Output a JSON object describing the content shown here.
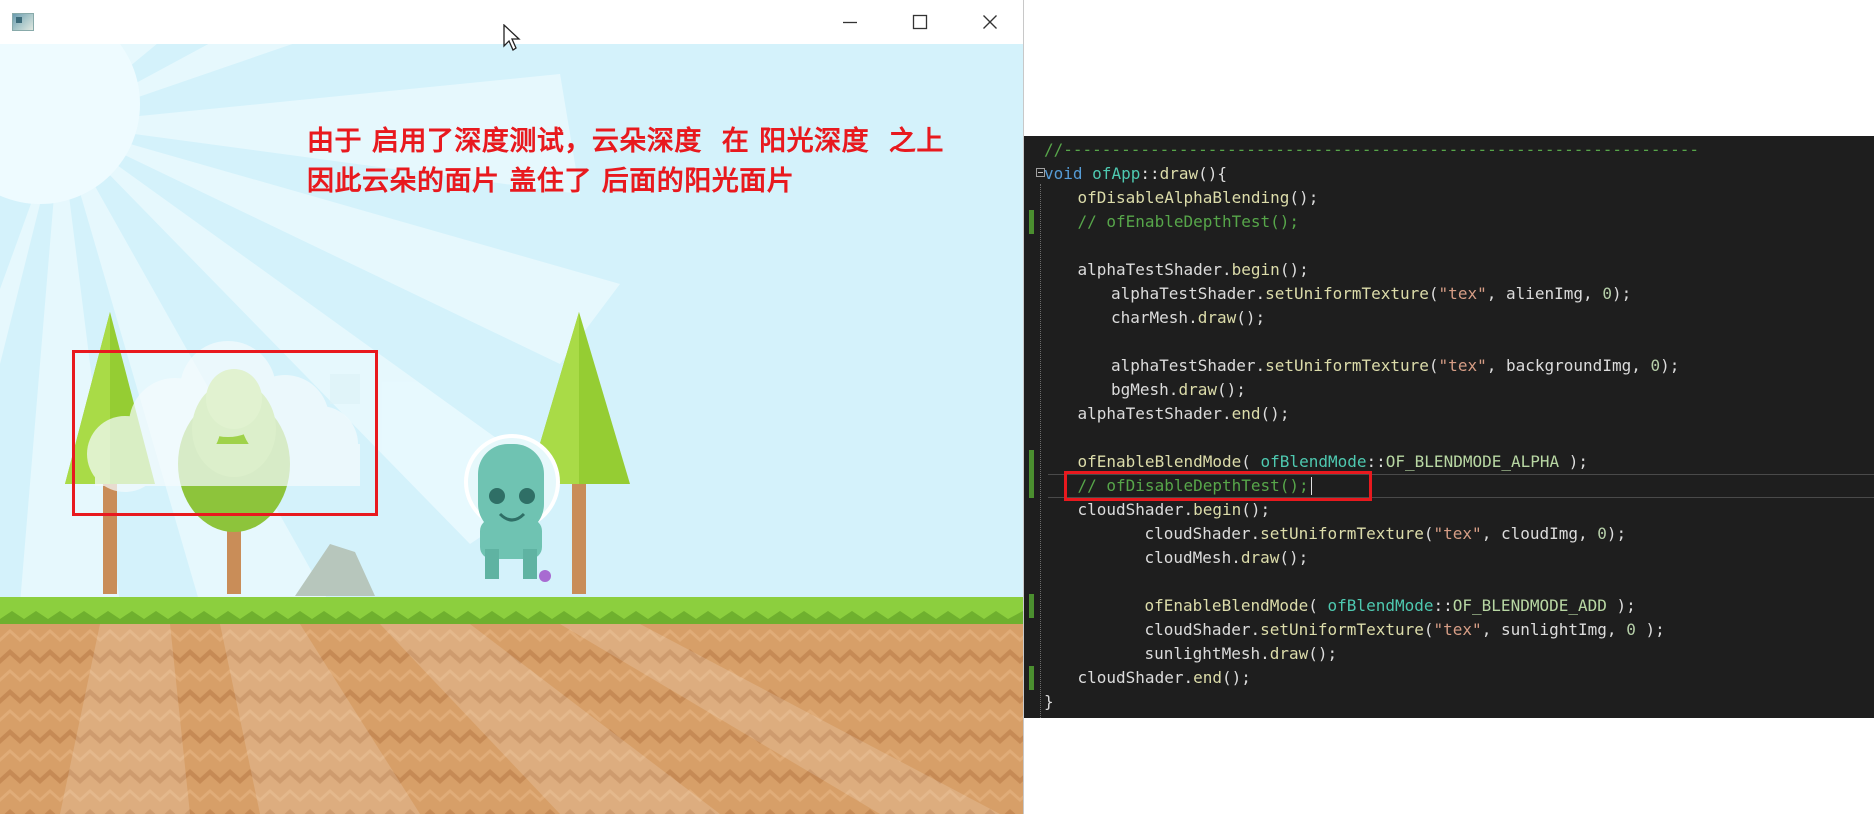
{
  "window": {
    "title": "",
    "controls": {
      "minimize_icon": "minimize-icon",
      "maximize_icon": "maximize-icon",
      "close_icon": "close-icon"
    }
  },
  "scene": {
    "annotation": "由于 启用了深度测试，云朵深度  在 阳光深度  之上\n因此云朵的面片 盖住了 后面的阳光面片",
    "colors": {
      "sky": "#d4f2fb",
      "sun_rays": "#e6f8fe",
      "grass": "#8ccf3e",
      "dirt": "#d79f68",
      "tree_foliage": "#95cd33",
      "trunk": "#c98d58",
      "alien": "#6fc3b2",
      "highlight": "#e8191e"
    }
  },
  "code": {
    "colors": {
      "background": "#1e1e1e",
      "comment": "#57a64a",
      "keyword": "#569cd6",
      "type": "#4ec9b0",
      "function": "#dcdcaa",
      "string": "#d69d85",
      "number": "#b5cea8",
      "plain": "#dcdcdc",
      "change_marker": "#4b8f2f"
    },
    "lines": [
      {
        "indent": 0,
        "changed": false,
        "tokens": [
          {
            "t": "//------------------------------------------------------------------",
            "c": "comment"
          }
        ]
      },
      {
        "indent": 0,
        "changed": false,
        "fold": true,
        "tokens": [
          {
            "t": "void ",
            "c": "keyword"
          },
          {
            "t": "ofApp",
            "c": "type"
          },
          {
            "t": "::",
            "c": "plain"
          },
          {
            "t": "draw",
            "c": "func"
          },
          {
            "t": "(){",
            "c": "plain"
          }
        ]
      },
      {
        "indent": 1,
        "changed": false,
        "tokens": [
          {
            "t": "ofDisableAlphaBlending",
            "c": "func"
          },
          {
            "t": "();",
            "c": "plain"
          }
        ]
      },
      {
        "indent": 1,
        "changed": true,
        "tokens": [
          {
            "t": "// ofEnableDepthTest();",
            "c": "comment"
          }
        ]
      },
      {
        "indent": 0,
        "changed": false,
        "tokens": []
      },
      {
        "indent": 1,
        "changed": false,
        "tokens": [
          {
            "t": "alphaTestShader",
            "c": "plain"
          },
          {
            "t": ".",
            "c": "plain"
          },
          {
            "t": "begin",
            "c": "func"
          },
          {
            "t": "();",
            "c": "plain"
          }
        ]
      },
      {
        "indent": 2,
        "changed": false,
        "tokens": [
          {
            "t": "alphaTestShader",
            "c": "plain"
          },
          {
            "t": ".",
            "c": "plain"
          },
          {
            "t": "setUniformTexture",
            "c": "func"
          },
          {
            "t": "(",
            "c": "plain"
          },
          {
            "t": "\"tex\"",
            "c": "string"
          },
          {
            "t": ", alienImg, ",
            "c": "plain"
          },
          {
            "t": "0",
            "c": "number"
          },
          {
            "t": ");",
            "c": "plain"
          }
        ]
      },
      {
        "indent": 2,
        "changed": false,
        "tokens": [
          {
            "t": "charMesh",
            "c": "plain"
          },
          {
            "t": ".",
            "c": "plain"
          },
          {
            "t": "draw",
            "c": "func"
          },
          {
            "t": "();",
            "c": "plain"
          }
        ]
      },
      {
        "indent": 0,
        "changed": false,
        "tokens": []
      },
      {
        "indent": 2,
        "changed": false,
        "tokens": [
          {
            "t": "alphaTestShader",
            "c": "plain"
          },
          {
            "t": ".",
            "c": "plain"
          },
          {
            "t": "setUniformTexture",
            "c": "func"
          },
          {
            "t": "(",
            "c": "plain"
          },
          {
            "t": "\"tex\"",
            "c": "string"
          },
          {
            "t": ", backgroundImg, ",
            "c": "plain"
          },
          {
            "t": "0",
            "c": "number"
          },
          {
            "t": ");",
            "c": "plain"
          }
        ]
      },
      {
        "indent": 2,
        "changed": false,
        "tokens": [
          {
            "t": "bgMesh",
            "c": "plain"
          },
          {
            "t": ".",
            "c": "plain"
          },
          {
            "t": "draw",
            "c": "func"
          },
          {
            "t": "();",
            "c": "plain"
          }
        ]
      },
      {
        "indent": 1,
        "changed": false,
        "tokens": [
          {
            "t": "alphaTestShader",
            "c": "plain"
          },
          {
            "t": ".",
            "c": "plain"
          },
          {
            "t": "end",
            "c": "func"
          },
          {
            "t": "();",
            "c": "plain"
          }
        ]
      },
      {
        "indent": 0,
        "changed": false,
        "tokens": []
      },
      {
        "indent": 1,
        "changed": true,
        "tokens": [
          {
            "t": "ofEnableBlendMode",
            "c": "func"
          },
          {
            "t": "( ",
            "c": "plain"
          },
          {
            "t": "ofBlendMode",
            "c": "type"
          },
          {
            "t": "::",
            "c": "plain"
          },
          {
            "t": "OF_BLENDMODE_ALPHA",
            "c": "enum"
          },
          {
            "t": " );",
            "c": "plain"
          }
        ]
      },
      {
        "indent": 1,
        "changed": true,
        "current": true,
        "tokens": [
          {
            "t": "// ofDisableDepthTest();",
            "c": "comment"
          }
        ]
      },
      {
        "indent": 1,
        "changed": false,
        "tokens": [
          {
            "t": "cloudShader",
            "c": "plain"
          },
          {
            "t": ".",
            "c": "plain"
          },
          {
            "t": "begin",
            "c": "func"
          },
          {
            "t": "();",
            "c": "plain"
          }
        ]
      },
      {
        "indent": 3,
        "changed": false,
        "tokens": [
          {
            "t": "cloudShader",
            "c": "plain"
          },
          {
            "t": ".",
            "c": "plain"
          },
          {
            "t": "setUniformTexture",
            "c": "func"
          },
          {
            "t": "(",
            "c": "plain"
          },
          {
            "t": "\"tex\"",
            "c": "string"
          },
          {
            "t": ", cloudImg, ",
            "c": "plain"
          },
          {
            "t": "0",
            "c": "number"
          },
          {
            "t": ");",
            "c": "plain"
          }
        ]
      },
      {
        "indent": 3,
        "changed": false,
        "tokens": [
          {
            "t": "cloudMesh",
            "c": "plain"
          },
          {
            "t": ".",
            "c": "plain"
          },
          {
            "t": "draw",
            "c": "func"
          },
          {
            "t": "();",
            "c": "plain"
          }
        ]
      },
      {
        "indent": 0,
        "changed": false,
        "tokens": []
      },
      {
        "indent": 3,
        "changed": true,
        "tokens": [
          {
            "t": "ofEnableBlendMode",
            "c": "func"
          },
          {
            "t": "( ",
            "c": "plain"
          },
          {
            "t": "ofBlendMode",
            "c": "type"
          },
          {
            "t": "::",
            "c": "plain"
          },
          {
            "t": "OF_BLENDMODE_ADD",
            "c": "enum"
          },
          {
            "t": " );",
            "c": "plain"
          }
        ]
      },
      {
        "indent": 3,
        "changed": false,
        "tokens": [
          {
            "t": "cloudShader",
            "c": "plain"
          },
          {
            "t": ".",
            "c": "plain"
          },
          {
            "t": "setUniformTexture",
            "c": "func"
          },
          {
            "t": "(",
            "c": "plain"
          },
          {
            "t": "\"tex\"",
            "c": "string"
          },
          {
            "t": ", sunlightImg, ",
            "c": "plain"
          },
          {
            "t": "0",
            "c": "number"
          },
          {
            "t": " );",
            "c": "plain"
          }
        ]
      },
      {
        "indent": 3,
        "changed": false,
        "tokens": [
          {
            "t": "sunlightMesh",
            "c": "plain"
          },
          {
            "t": ".",
            "c": "plain"
          },
          {
            "t": "draw",
            "c": "func"
          },
          {
            "t": "();",
            "c": "plain"
          }
        ]
      },
      {
        "indent": 1,
        "changed": true,
        "tokens": [
          {
            "t": "cloudShader",
            "c": "plain"
          },
          {
            "t": ".",
            "c": "plain"
          },
          {
            "t": "end",
            "c": "func"
          },
          {
            "t": "();",
            "c": "plain"
          }
        ]
      },
      {
        "indent": 0,
        "changed": false,
        "tokens": [
          {
            "t": "}",
            "c": "plain"
          }
        ]
      }
    ]
  }
}
